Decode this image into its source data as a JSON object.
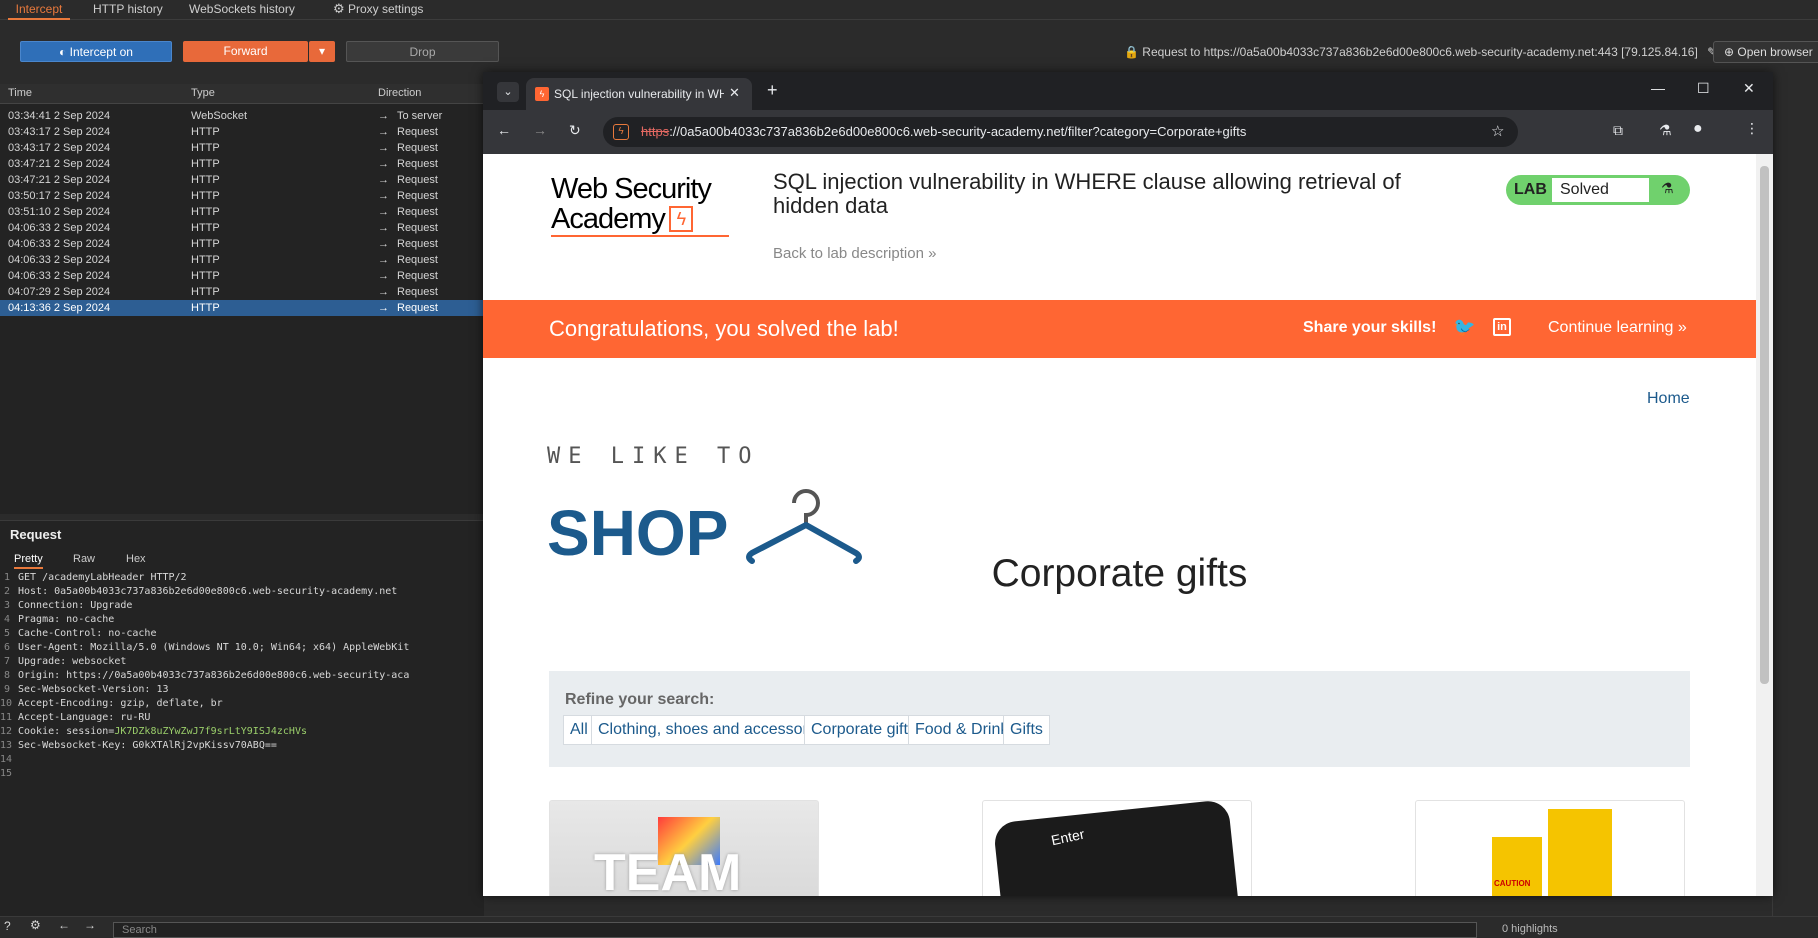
{
  "burp": {
    "tabs": [
      "Intercept",
      "HTTP history",
      "WebSockets history",
      "Proxy settings"
    ],
    "intercept_button": "Intercept on",
    "forward_button": "Forward",
    "drop_button": "Drop",
    "request_to": "Request to https://0a5a00b4033c737a836b2e6d00e800c6.web-security-academy.net:443  [79.125.84.16]",
    "open_browser": "Open browser",
    "history_headers": [
      "Time",
      "Type",
      "Direction"
    ],
    "history_rows": [
      {
        "time": "03:34:41 2 Sep 2024",
        "type": "WebSocket",
        "direction": "To server"
      },
      {
        "time": "03:43:17 2 Sep 2024",
        "type": "HTTP",
        "direction": "Request"
      },
      {
        "time": "03:43:17 2 Sep 2024",
        "type": "HTTP",
        "direction": "Request"
      },
      {
        "time": "03:47:21 2 Sep 2024",
        "type": "HTTP",
        "direction": "Request"
      },
      {
        "time": "03:47:21 2 Sep 2024",
        "type": "HTTP",
        "direction": "Request"
      },
      {
        "time": "03:50:17 2 Sep 2024",
        "type": "HTTP",
        "direction": "Request"
      },
      {
        "time": "03:51:10 2 Sep 2024",
        "type": "HTTP",
        "direction": "Request"
      },
      {
        "time": "04:06:33 2 Sep 2024",
        "type": "HTTP",
        "direction": "Request"
      },
      {
        "time": "04:06:33 2 Sep 2024",
        "type": "HTTP",
        "direction": "Request"
      },
      {
        "time": "04:06:33 2 Sep 2024",
        "type": "HTTP",
        "direction": "Request"
      },
      {
        "time": "04:06:33 2 Sep 2024",
        "type": "HTTP",
        "direction": "Request"
      },
      {
        "time": "04:07:29 2 Sep 2024",
        "type": "HTTP",
        "direction": "Request"
      },
      {
        "time": "04:13:36 2 Sep 2024",
        "type": "HTTP",
        "direction": "Request"
      }
    ],
    "request_title": "Request",
    "request_tabs": [
      "Pretty",
      "Raw",
      "Hex"
    ],
    "request_lines": [
      "GET /academyLabHeader HTTP/2",
      "Host: 0a5a00b4033c737a836b2e6d00e800c6.web-security-academy.net",
      "Connection: Upgrade",
      "Pragma: no-cache",
      "Cache-Control: no-cache",
      "User-Agent: Mozilla/5.0 (Windows NT 10.0; Win64; x64) AppleWebKit",
      "Upgrade: websocket",
      "Origin: https://0a5a00b4033c737a836b2e6d00e800c6.web-security-aca",
      "Sec-Websocket-Version: 13",
      "Accept-Encoding: gzip, deflate, br",
      "Accept-Language: ru-RU",
      "Cookie: session=",
      "Sec-Websocket-Key: G0kXTAlRj2vpKissv70ABQ==",
      "",
      ""
    ],
    "cookie_value": "JK7DZk8uZYwZwJ7f9srLtY9ISJ4zcHVs",
    "search_placeholder": "Search",
    "highlights": "0 highlights"
  },
  "browser": {
    "tab_title": "SQL injection vulnerability in WH",
    "url_scheme": "https",
    "url_rest": "://0a5a00b4033c737a836b2e6d00e800c6.web-security-academy.net/filter?category=Corporate+gifts"
  },
  "page": {
    "logo_line1": "Web Security",
    "logo_line2": "Academy",
    "lab_title": "SQL injection vulnerability in WHERE clause allowing retrieval of hidden data",
    "back_link": "Back to lab description",
    "lab_label": "LAB",
    "lab_status": "Solved",
    "congrats": "Congratulations, you solved the lab!",
    "share": "Share your skills!",
    "continue": "Continue learning",
    "home": "Home",
    "shop_line1": "WE LIKE TO",
    "shop_line2": "SHOP",
    "heading": "Corporate gifts",
    "refine_label": "Refine your search:",
    "filters": [
      "All",
      "Clothing, shoes and accessories",
      "Corporate gifts",
      "Food & Drink",
      "Gifts"
    ],
    "product_texts": [
      "TEAM",
      "Enter",
      "CAUTION"
    ]
  },
  "colors": {
    "accent": "#ff6633",
    "lab_green": "#70d16d",
    "link": "#1c5a8c",
    "burp_orange": "#e8693a",
    "burp_blue": "#2f6fb8"
  }
}
